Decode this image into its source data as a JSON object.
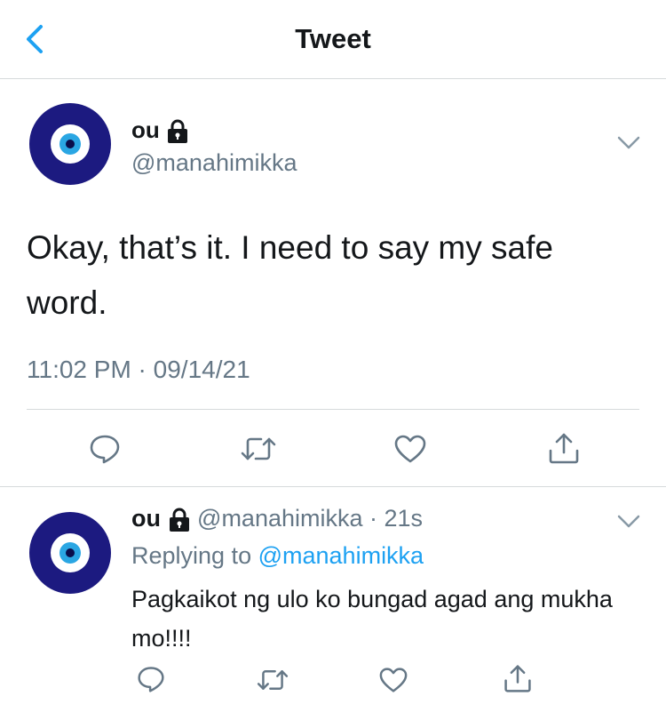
{
  "header": {
    "title": "Tweet"
  },
  "tweet": {
    "display_name": "ou",
    "handle": "@manahimikka",
    "text": "Okay, that’s it. I need to say my safe word.",
    "timestamp": "11:02 PM · 09/14/21"
  },
  "reply": {
    "display_name": "ou",
    "handle": "@manahimikka",
    "time": "· 21s",
    "replying_to_label": "Replying to",
    "replying_to_handle": "@manahimikka",
    "text": "Pagkaikot ng ulo ko bungad agad ang mukha mo!!!!"
  },
  "icons": {
    "back": "chevron-left-icon",
    "lock": "lock-icon",
    "more": "chevron-down-icon",
    "reply": "comment-icon",
    "retweet": "retweet-icon",
    "like": "heart-icon",
    "share": "share-icon"
  },
  "colors": {
    "accent": "#1da1f2",
    "secondary_text": "#657786",
    "avatar_navy": "#1c1a80"
  }
}
